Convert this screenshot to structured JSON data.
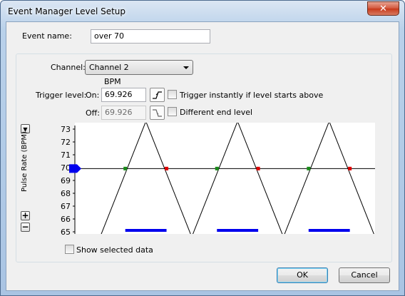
{
  "window": {
    "title": "Event Manager Level Setup",
    "close_glyph": "✕"
  },
  "event_name": {
    "label": "Event name:",
    "value": "over 70"
  },
  "channel": {
    "label": "Channel:",
    "selected": "Channel 2"
  },
  "trigger": {
    "unit": "BPM",
    "label": "Trigger level:",
    "on_label": "On:",
    "on_value": "69.926",
    "off_label": "Off:",
    "off_value": "69.926",
    "rising_icon": "rising-edge-icon",
    "falling_icon": "falling-edge-icon",
    "instant_label": "Trigger instantly if level starts above",
    "instant_checked": false,
    "end_label": "Different end level",
    "end_checked": false
  },
  "chart_controls": {
    "down": "▼",
    "plus": "+",
    "minus": "−"
  },
  "show_selected": {
    "label": "Show selected data",
    "checked": false
  },
  "buttons": {
    "ok": "OK",
    "cancel": "Cancel"
  },
  "chart_data": {
    "type": "line",
    "ylabel": "Pulse Rate (BPM)",
    "ylim": [
      65,
      73
    ],
    "yticks": [
      "73",
      "72",
      "71",
      "70",
      "69",
      "68",
      "67",
      "66",
      "65"
    ],
    "series": [
      {
        "values": [
          {
            "x": 0,
            "y": 64.6
          },
          {
            "x": 1,
            "y": 73.6
          },
          {
            "x": 2,
            "y": 64.6
          },
          {
            "x": 3,
            "y": 73.6
          },
          {
            "x": 4,
            "y": 64.6
          },
          {
            "x": 5,
            "y": 73.6
          },
          {
            "x": 6,
            "y": 64.6
          }
        ]
      }
    ],
    "trigger_level": 69.926,
    "event_starts": [
      0.55,
      2.55,
      4.55
    ],
    "event_ends": [
      1.45,
      3.45,
      5.45
    ],
    "colors": {
      "line": "#000000",
      "start": "#1a8a1a",
      "end": "#dd0000",
      "event": "#0000ee",
      "handle": "#0000ee"
    }
  }
}
